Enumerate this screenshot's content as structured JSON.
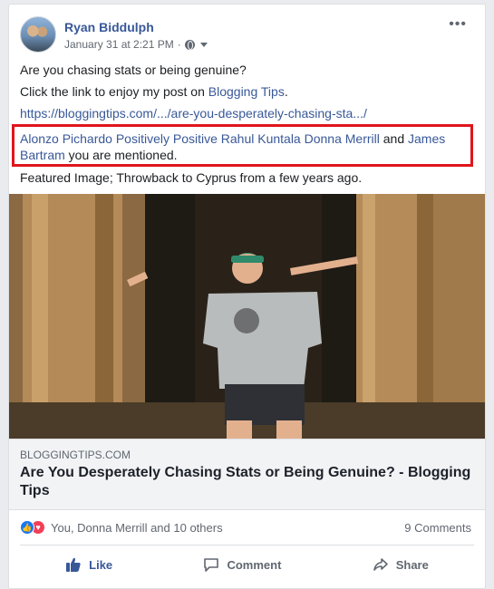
{
  "post": {
    "author": "Ryan Biddulph",
    "timestamp": "January 31 at 2:21 PM",
    "separator": "·",
    "more_icon": "more-horizontal-icon",
    "lines": [
      "Are you chasing stats or being genuine?",
      "Click the link to enjoy my post on ",
      "https://bloggingtips.com/.../are-you-desperately-chasing-sta.../"
    ],
    "blogging_tips_link": "Blogging Tips",
    "period": ".",
    "mentions": {
      "names_1": "Alonzo Pichardo Positively Positive Rahul Kuntala Donna Merrill",
      "and": " and ",
      "names_2a": "James",
      "names_2b": "Bartram",
      "suffix": " you are mentioned."
    },
    "featured": "Featured Image; Throwback to Cyprus from a few years ago."
  },
  "link_preview": {
    "domain": "BLOGGINGTIPS.COM",
    "title": "Are You Desperately Chasing Stats or Being Genuine? - Blogging Tips"
  },
  "engagement": {
    "reactions_text": "You, Donna Merrill and 10 others",
    "comments_text": "9 Comments"
  },
  "actions": {
    "like": "Like",
    "comment": "Comment",
    "share": "Share"
  },
  "colors": {
    "link": "#385898",
    "highlight_border": "#e0151b",
    "like_blue": "#1877f2",
    "love_red": "#f33e58"
  }
}
